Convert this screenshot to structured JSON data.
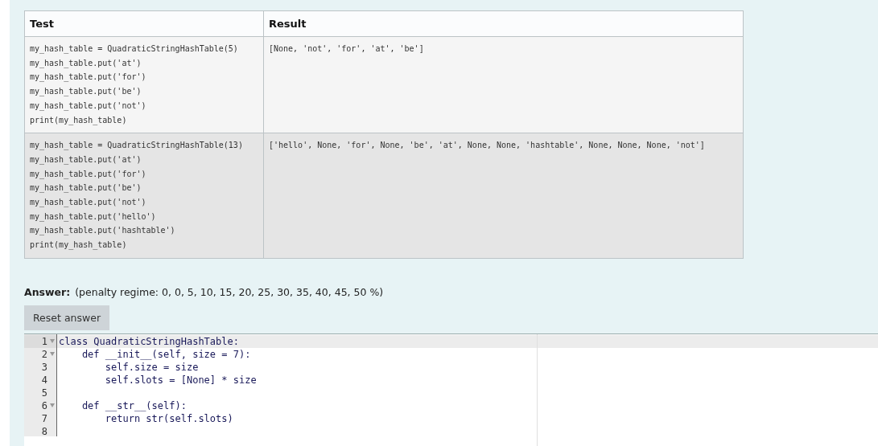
{
  "table": {
    "columns": [
      "Test",
      "Result"
    ],
    "rows": [
      {
        "test": [
          "my_hash_table = QuadraticStringHashTable(5)",
          "my_hash_table.put('at')",
          "my_hash_table.put('for')",
          "my_hash_table.put('be')",
          "my_hash_table.put('not')",
          "print(my_hash_table)"
        ],
        "result": "[None, 'not', 'for', 'at', 'be']"
      },
      {
        "test": [
          "my_hash_table = QuadraticStringHashTable(13)",
          "my_hash_table.put('at')",
          "my_hash_table.put('for')",
          "my_hash_table.put('be')",
          "my_hash_table.put('not')",
          "my_hash_table.put('hello')",
          "my_hash_table.put('hashtable')",
          "print(my_hash_table)"
        ],
        "result": "['hello', None, 'for', None, 'be', 'at', None, None, 'hashtable', None, None, None, 'not']"
      }
    ]
  },
  "answer": {
    "label": "Answer:",
    "penalty": "(penalty regime: 0, 0, 5, 10, 15, 20, 25, 30, 35, 40, 45, 50 %)"
  },
  "reset_button": "Reset answer",
  "editor": {
    "lines": [
      {
        "number": "1",
        "text": "class QuadraticStringHashTable:",
        "foldable": true,
        "active": true
      },
      {
        "number": "2",
        "text": "    def __init__(self, size = 7):",
        "foldable": true,
        "active": false
      },
      {
        "number": "3",
        "text": "        self.size = size",
        "foldable": false,
        "active": false
      },
      {
        "number": "4",
        "text": "        self.slots = [None] * size",
        "foldable": false,
        "active": false
      },
      {
        "number": "5",
        "foldable": false,
        "active": false
      },
      {
        "number": "6",
        "text": "    def __str__(self):",
        "foldable": true,
        "active": false
      },
      {
        "number": "7",
        "text": "        return str(self.slots)",
        "foldable": false,
        "active": false
      },
      {
        "number": "8",
        "foldable": false,
        "active": false
      }
    ]
  }
}
